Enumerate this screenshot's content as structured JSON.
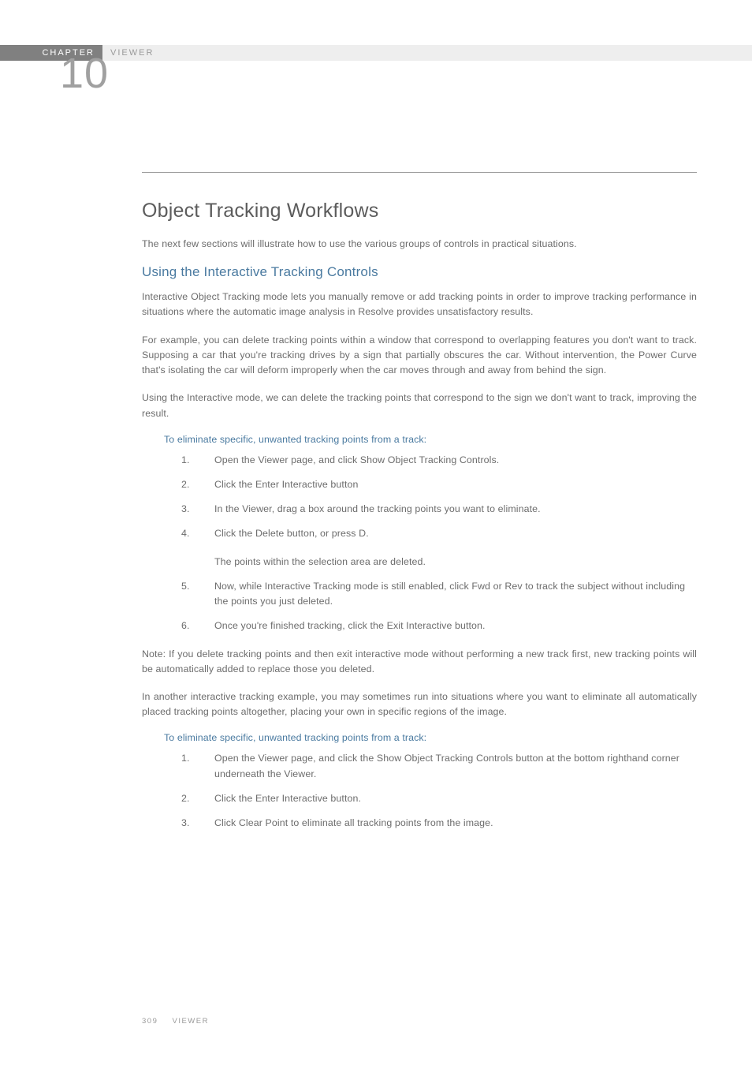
{
  "header": {
    "chapter_label": "CHAPTER",
    "chapter_name": "VIEWER",
    "chapter_number": "10"
  },
  "section_title": "Object Tracking Workflows",
  "intro": "The next few sections will illustrate how to use the various groups of controls in practical situations.",
  "sub_title": "Using the Interactive Tracking Controls",
  "p1": "Interactive Object Tracking mode lets you manually remove or add tracking points in order to improve tracking performance in situations where the automatic image analysis in Resolve provides unsatisfactory results.",
  "p2": "For example, you can delete tracking points within a window that correspond to overlapping features you don't want to track. Supposing a car that you're tracking drives by a sign that partially obscures the car. Without intervention, the Power Curve that's isolating the car will deform improperly when the car moves through and away from behind the sign.",
  "p3": "Using the Interactive mode, we can delete the tracking points that correspond to the sign we don't want to track, improving the result.",
  "inst1": "To eliminate specific, unwanted tracking points from a track:",
  "steps1": [
    {
      "n": "1.",
      "t": "Open the Viewer page, and click Show Object Tracking Controls."
    },
    {
      "n": "2.",
      "t": "Click the Enter Interactive button"
    },
    {
      "n": "3.",
      "t": "In the Viewer, drag a box around the tracking points you want to eliminate."
    },
    {
      "n": "4.",
      "t": "Click the Delete button, or press D."
    }
  ],
  "step4_note": "The points within the selection area are deleted.",
  "steps1b": [
    {
      "n": "5.",
      "t": "Now, while Interactive Tracking mode is still enabled, click Fwd or Rev to track the subject without including the points you just deleted."
    },
    {
      "n": "6.",
      "t": "Once you're finished tracking, click the Exit Interactive button."
    }
  ],
  "note": "Note: If you delete tracking points and then exit interactive mode without performing a new track first, new tracking points will be automatically added to replace those you deleted.",
  "p4": "In another interactive tracking example, you may sometimes run into situations where you want to eliminate all automatically placed tracking points altogether, placing your own in specific regions of the image.",
  "inst2": "To eliminate specific, unwanted tracking points from a track:",
  "steps2": [
    {
      "n": "1.",
      "t": "Open the Viewer page, and click the Show Object Tracking Controls button at the bottom righthand corner underneath the Viewer."
    },
    {
      "n": "2.",
      "t": "Click the Enter Interactive button."
    },
    {
      "n": "3.",
      "t": "Click Clear Point to eliminate all tracking points from the image."
    }
  ],
  "footer": {
    "page_num": "309",
    "label": "VIEWER"
  }
}
